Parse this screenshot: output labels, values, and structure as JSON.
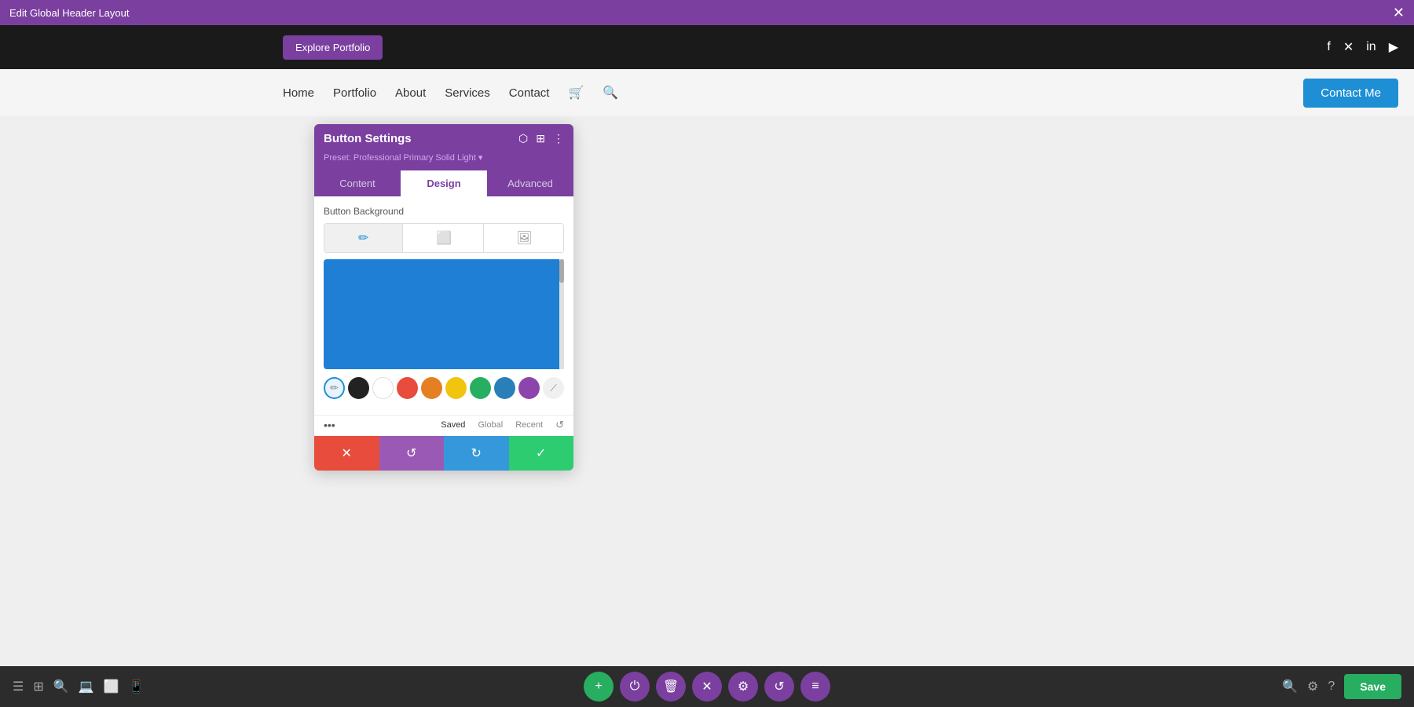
{
  "topBar": {
    "title": "Edit Global Header Layout",
    "closeIcon": "✕"
  },
  "headerPreview": {
    "exploreBtn": "Explore Portfolio",
    "socialIcons": [
      "f",
      "𝕏",
      "in",
      "▶"
    ]
  },
  "nav": {
    "links": [
      "Home",
      "Portfolio",
      "About",
      "Services",
      "Contact"
    ],
    "contactBtn": "Contact Me"
  },
  "panel": {
    "title": "Button Settings",
    "preset": "Preset: Professional Primary Solid Light ▾",
    "tabs": [
      "Content",
      "Design",
      "Advanced"
    ],
    "activeTab": "Design",
    "sectionLabel": "Button Background",
    "bgTypeIcons": [
      "🎨",
      "🖼",
      "🖼"
    ],
    "colorValue": "#1e7fd5",
    "swatches": [
      {
        "color": "#1e7fd5",
        "active": true
      },
      {
        "color": "#222222"
      },
      {
        "color": "#ffffff"
      },
      {
        "color": "#e74c3c"
      },
      {
        "color": "#e67e22"
      },
      {
        "color": "#f1c40f"
      },
      {
        "color": "#27ae60"
      },
      {
        "color": "#2980b9"
      },
      {
        "color": "#8e44ad"
      }
    ],
    "bottomTabs": [
      "Saved",
      "Global",
      "Recent"
    ],
    "actions": {
      "cancel": "✕",
      "undo": "↺",
      "redo": "↻",
      "confirm": "✓"
    }
  },
  "bottomToolbar": {
    "leftIcons": [
      "☰",
      "⊞",
      "🔍",
      "💻",
      "📱",
      "📱"
    ],
    "centerButtons": [
      "+",
      "⏻",
      "🗑",
      "✕",
      "⚙",
      "↺",
      "≡"
    ],
    "rightIcons": [
      "🔍",
      "⚙",
      "?"
    ],
    "saveLabel": "Save"
  }
}
